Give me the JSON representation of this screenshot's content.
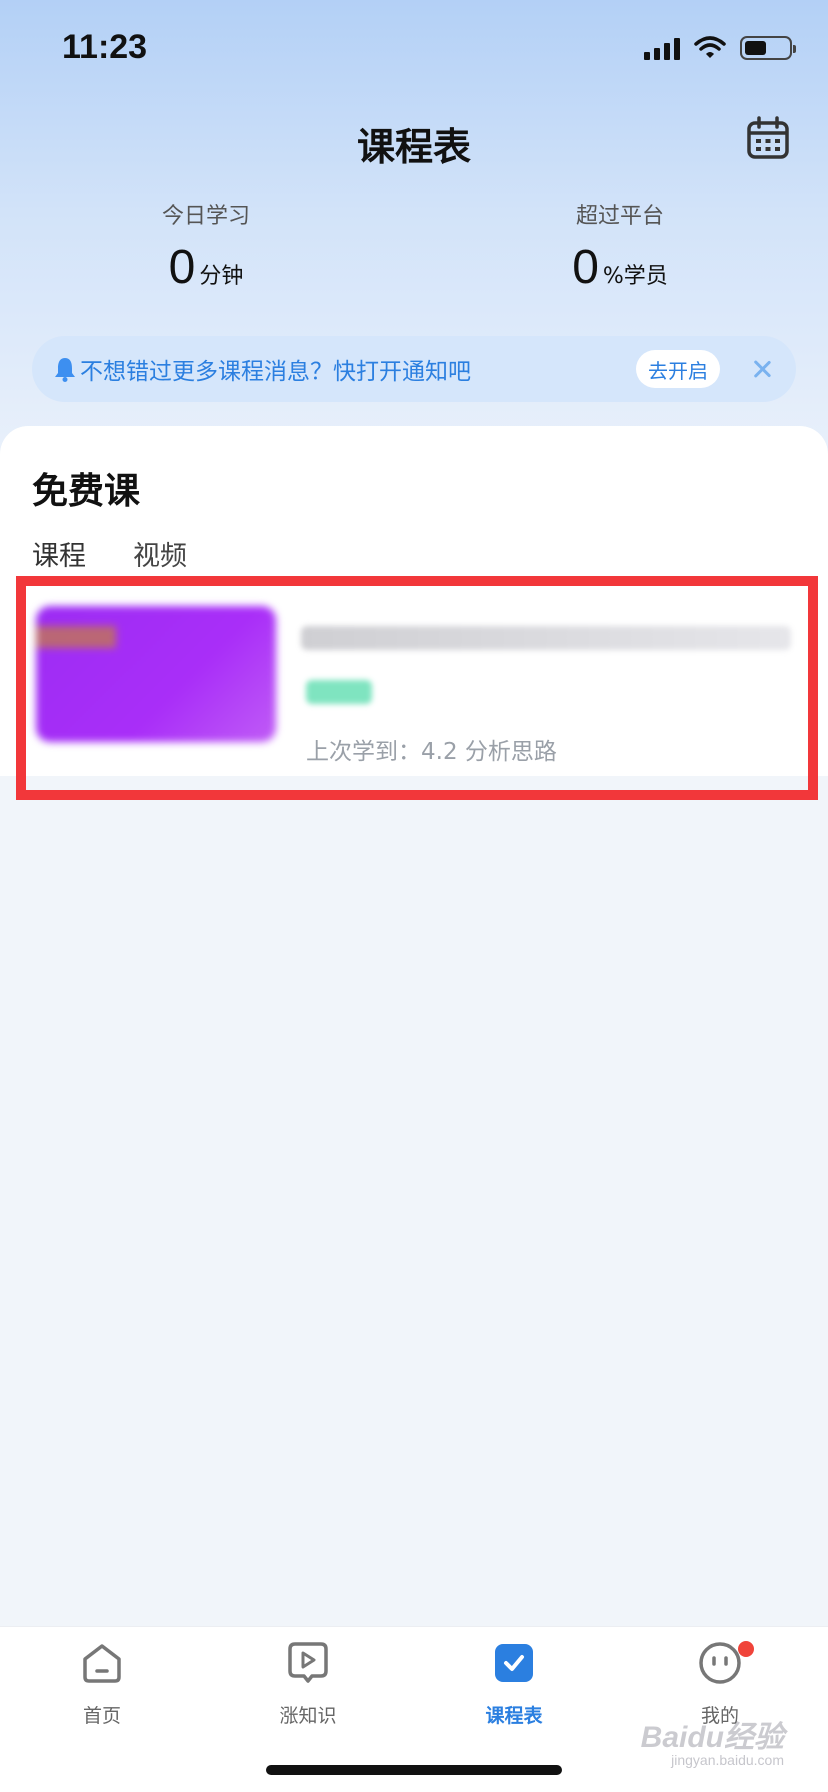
{
  "status_bar": {
    "time": "11:23"
  },
  "header": {
    "title": "课程表"
  },
  "stats": {
    "today": {
      "label": "今日学习",
      "value": "0",
      "unit": "分钟"
    },
    "rank": {
      "label": "超过平台",
      "value": "0",
      "unit": "%学员"
    }
  },
  "notice": {
    "text": "不想错过更多课程消息？快打开通知吧",
    "action_label": "去开启"
  },
  "section": {
    "title": "免费课",
    "tabs": [
      {
        "label": "课程"
      },
      {
        "label": "视频"
      }
    ]
  },
  "course_card": {
    "progress_text": "上次学到：4.2 分析思路"
  },
  "tabbar": {
    "items": [
      {
        "label": "首页"
      },
      {
        "label": "涨知识"
      },
      {
        "label": "课程表"
      },
      {
        "label": "我的"
      }
    ]
  },
  "watermark": {
    "text": "Baidu经验",
    "sub": "jingyan.baidu.com"
  },
  "colors": {
    "accent": "#2b7fe0",
    "highlight": "#f2373a",
    "badge": "#f0443a",
    "thumb": "#a92ef8"
  }
}
